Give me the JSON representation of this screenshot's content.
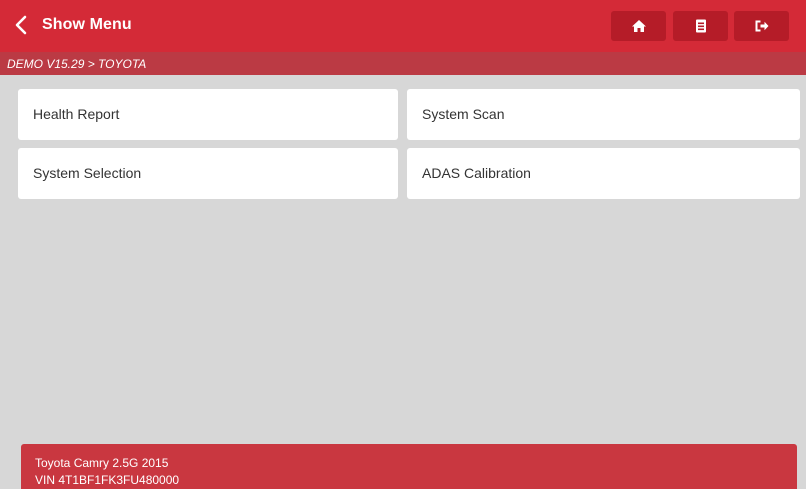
{
  "header": {
    "title": "Show Menu",
    "back_icon": "chevron-left-icon",
    "buttons": [
      {
        "name": "home",
        "icon": "home-icon"
      },
      {
        "name": "report",
        "icon": "report-icon"
      },
      {
        "name": "exit",
        "icon": "exit-icon"
      }
    ]
  },
  "breadcrumb": "DEMO V15.29 > TOYOTA",
  "menu": {
    "items": [
      {
        "label": "Health Report"
      },
      {
        "label": "System Scan"
      },
      {
        "label": "System Selection"
      },
      {
        "label": "ADAS Calibration"
      }
    ]
  },
  "vehicle": {
    "model": "Toyota Camry 2.5G 2015",
    "vin": "VIN 4T1BF1FK3FU480000"
  },
  "colors": {
    "header": "#d42a37",
    "breadcrumb_bar": "#bb3a44",
    "button": "#b51c28",
    "footer": "#c93740",
    "background": "#d7d7d7"
  }
}
